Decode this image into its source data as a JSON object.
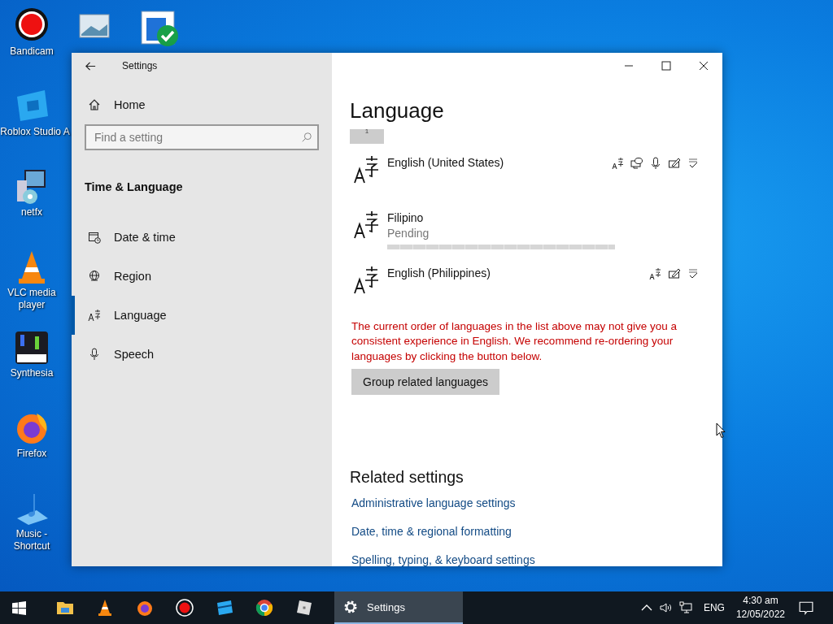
{
  "desktop": {
    "top_icons": [
      {
        "kind": "pictures"
      },
      {
        "kind": "default"
      }
    ],
    "icons": [
      {
        "kind": "bandicam",
        "label": "Bandicam"
      },
      {
        "kind": "roblox-studio",
        "label": "Roblox Studio A"
      },
      {
        "kind": "installer",
        "label": "netfx"
      },
      {
        "kind": "vlc",
        "label": "VLC media player"
      },
      {
        "kind": "synthesia",
        "label": "Synthesia"
      },
      {
        "kind": "firefox",
        "label": "Firefox"
      },
      {
        "kind": "music",
        "label": "Music - Shortcut"
      }
    ]
  },
  "window": {
    "title": "Settings",
    "sidebar": {
      "home": "Home",
      "search": {
        "placeholder": "Find a setting"
      },
      "section": "Time & Language",
      "items": [
        {
          "kind": "date",
          "label": "Date & time",
          "selected": false
        },
        {
          "kind": "region",
          "label": "Region",
          "selected": false
        },
        {
          "kind": "language",
          "label": "Language",
          "selected": true
        },
        {
          "kind": "speech",
          "label": "Speech",
          "selected": false
        }
      ]
    },
    "content": {
      "title": "Language",
      "partial_button": "1",
      "languages": [
        {
          "name": "English (United States)",
          "features": [
            {
              "kind": "display"
            },
            {
              "kind": "speech"
            },
            {
              "kind": "microphone"
            },
            {
              "kind": "handwriting"
            },
            {
              "kind": "spelling"
            }
          ]
        },
        {
          "name": "Filipino",
          "status": "Pending",
          "downloading": true
        },
        {
          "name": "English (Philippines)",
          "features": [
            {
              "kind": "display"
            },
            {
              "kind": "handwriting"
            },
            {
              "kind": "spelling"
            }
          ]
        }
      ],
      "warning": "The current order of languages in the list above may not give you a consistent experience in English. We recommend re-ordering your languages by clicking the button below.",
      "group_button": "Group related languages",
      "related_title": "Related settings",
      "related_links": [
        "Administrative language settings",
        "Date, time & regional formatting",
        "Spelling, typing, & keyboard settings"
      ]
    }
  },
  "taskbar": {
    "apps": [
      {
        "kind": "explorer"
      },
      {
        "kind": "vlc"
      },
      {
        "kind": "firefox"
      },
      {
        "kind": "bandicam"
      },
      {
        "kind": "roblox-studio"
      },
      {
        "kind": "chrome"
      },
      {
        "kind": "roblox"
      }
    ],
    "active_app": {
      "label": "Settings",
      "selected": true
    },
    "language": "ENG",
    "time": "4:30 am",
    "date": "12/05/2022"
  }
}
